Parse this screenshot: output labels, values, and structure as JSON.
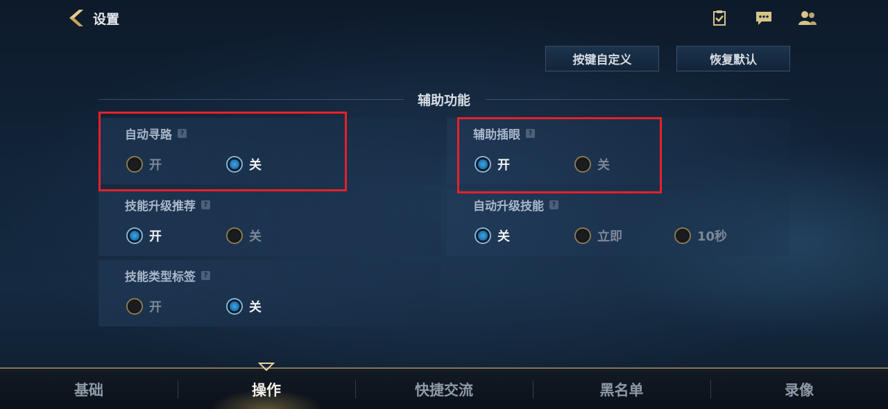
{
  "header": {
    "title": "设置",
    "icons": [
      "task-icon",
      "chat-icon",
      "friends-icon"
    ]
  },
  "buttons": {
    "custom_keys": "按键自定义",
    "restore_default": "恢复默认"
  },
  "section": {
    "title": "辅助功能"
  },
  "settings": {
    "auto_pathfinding": {
      "label": "自动寻路",
      "options": [
        "开",
        "关"
      ],
      "selected": "关"
    },
    "auto_ward": {
      "label": "辅助插眼",
      "options": [
        "开",
        "关"
      ],
      "selected": "开"
    },
    "skill_upgrade_recommend": {
      "label": "技能升级推荐",
      "options": [
        "开",
        "关"
      ],
      "selected": "开"
    },
    "auto_skill_upgrade": {
      "label": "自动升级技能",
      "options": [
        "关",
        "立即",
        "10秒"
      ],
      "selected": "关"
    },
    "skill_type_tag": {
      "label": "技能类型标签",
      "options": [
        "开",
        "关"
      ],
      "selected": "关"
    }
  },
  "help_mark": "?",
  "nav": {
    "tabs": [
      "基础",
      "操作",
      "快捷交流",
      "黑名单",
      "录像"
    ],
    "active": "操作"
  },
  "colors": {
    "highlight": "#e8202a",
    "accent_gold": "#c9a45a",
    "radio_selected": "#3aa6e8"
  }
}
